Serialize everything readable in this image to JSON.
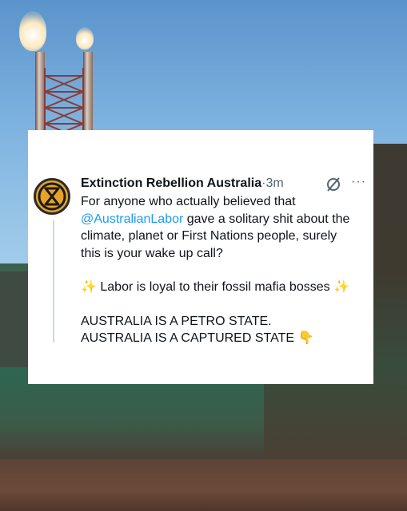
{
  "tweet": {
    "author": "Extinction Rebellion Australia",
    "separator": "·",
    "time": "3m",
    "more": "···",
    "line1": "For anyone who actually believed that",
    "mention": "@AustralianLabor",
    "line2_rest": " gave a solitary shit about the",
    "line3": "climate, planet or First Nations people, surely",
    "line4": "this is your wake up call?",
    "line5_sparkle_left": "✨",
    "line5_text": " Labor is loyal to their fossil mafia bosses ",
    "line5_sparkle_right": "✨",
    "line6": "AUSTRALIA IS A PETRO STATE.",
    "line7": "AUSTRALIA IS A CAPTURED STATE ",
    "line7_emoji": "👇"
  },
  "icons": {
    "avatar": "extinction-symbol-icon",
    "grok": "grok-icon",
    "more": "more-icon"
  },
  "colors": {
    "text": "#0f1419",
    "secondary": "#536471",
    "link": "#1d9bf0",
    "avatar_bg": "#e6a327"
  }
}
